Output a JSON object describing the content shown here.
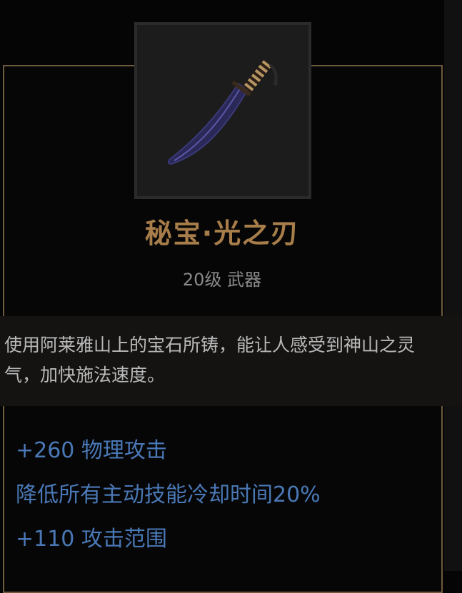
{
  "item": {
    "icon": "dagger-icon",
    "name": "秘宝·光之刃",
    "subtitle": "20级 武器",
    "description": "使用阿莱雅山上的宝石所铸，能让人感受到神山之灵气，加快施法速度。",
    "stats": [
      "+260 物理攻击",
      "降低所有主动技能冷却时间20%",
      "+110 攻击范围"
    ]
  },
  "colors": {
    "name": "#a77d4a",
    "stat": "#4a78b6",
    "border": "#6e5a3c"
  }
}
